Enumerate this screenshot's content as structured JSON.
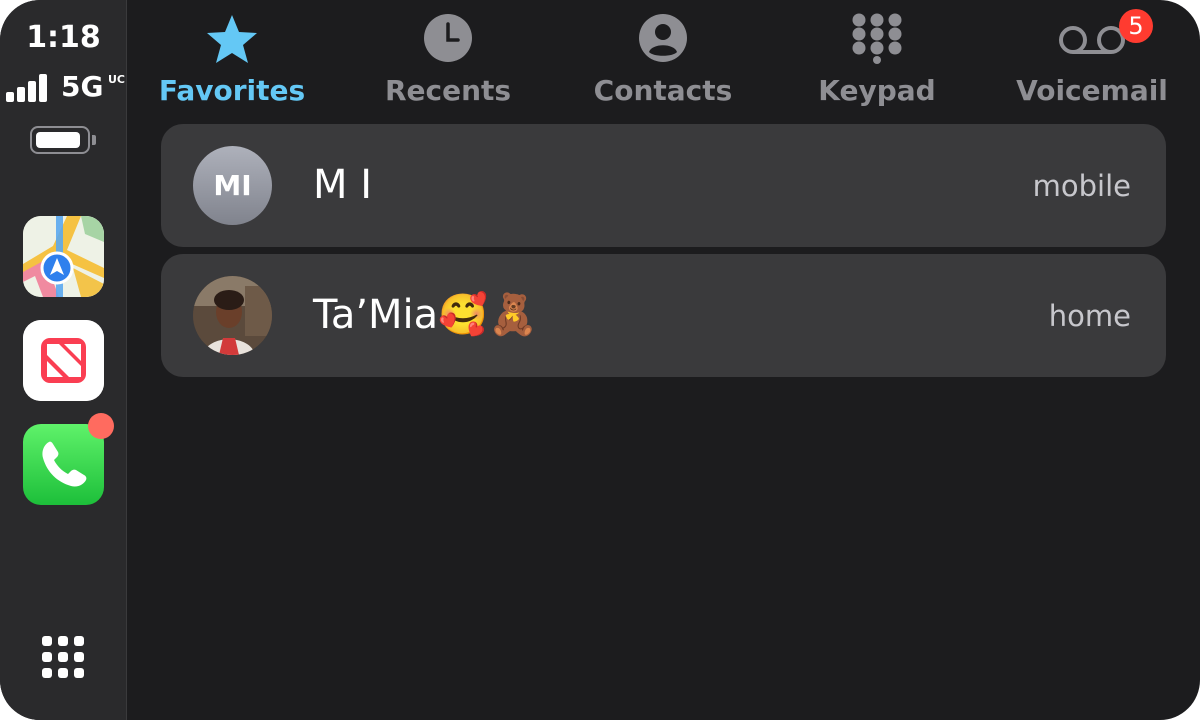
{
  "status": {
    "time": "1:18",
    "network": "5G",
    "network_suffix": "UC",
    "battery_percent": 100
  },
  "dock": {
    "apps": [
      {
        "name": "Maps",
        "icon": "maps-icon"
      },
      {
        "name": "News",
        "icon": "news-icon"
      },
      {
        "name": "Phone",
        "icon": "phone-icon",
        "badge": true
      }
    ],
    "app_grid_icon": "app-grid-icon"
  },
  "tabs": [
    {
      "label": "Favorites",
      "icon": "star-icon",
      "active": true
    },
    {
      "label": "Recents",
      "icon": "clock-icon",
      "active": false
    },
    {
      "label": "Contacts",
      "icon": "person-icon",
      "active": false
    },
    {
      "label": "Keypad",
      "icon": "keypad-icon",
      "active": false
    },
    {
      "label": "Voicemail",
      "icon": "voicemail-icon",
      "active": false,
      "badge": "5"
    }
  ],
  "favorites": [
    {
      "initials": "MI",
      "name": "M I",
      "type": "mobile"
    },
    {
      "initials": "",
      "name": "Ta’Mia🥰🧸",
      "type": "home"
    }
  ],
  "colors": {
    "accent": "#64c8f5",
    "badge": "#ff3b30",
    "row_bg": "#3a3a3c",
    "bg": "#1c1c1e"
  }
}
